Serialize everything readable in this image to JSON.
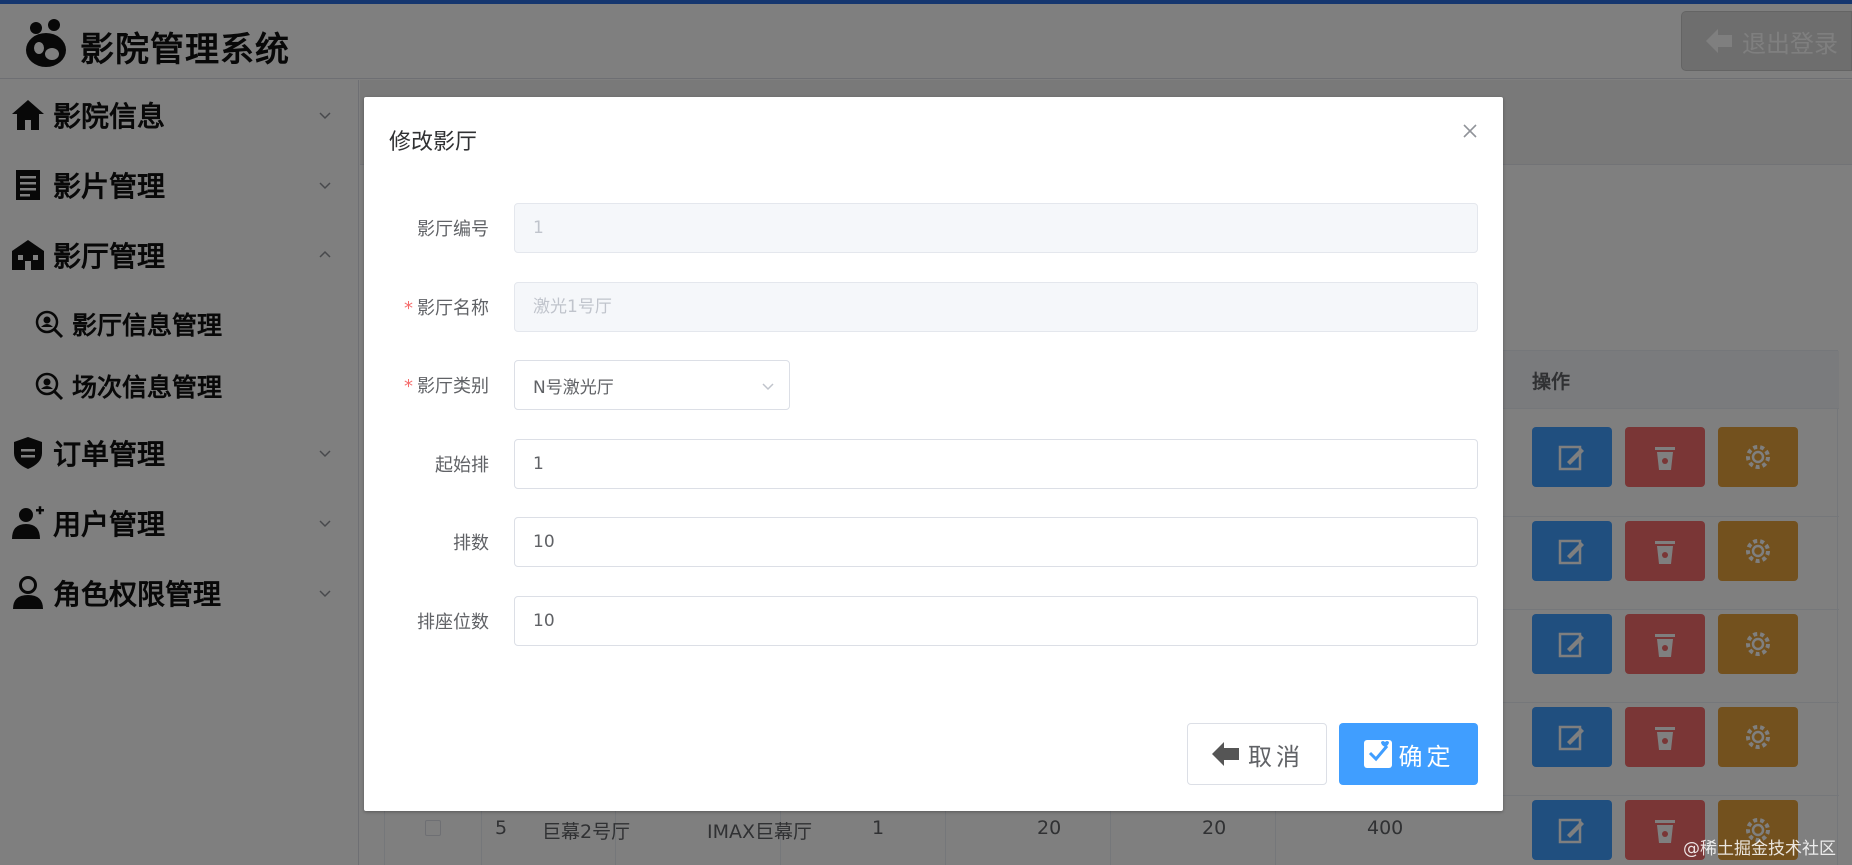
{
  "header": {
    "app_title": "影院管理系统",
    "logout_label": "退出登录"
  },
  "sidebar": {
    "items": [
      {
        "label": "影院信息"
      },
      {
        "label": "影片管理"
      },
      {
        "label": "影厅管理"
      },
      {
        "label": "订单管理"
      },
      {
        "label": "用户管理"
      },
      {
        "label": "角色权限管理"
      }
    ],
    "sub_items": [
      {
        "label": "影厅信息管理"
      },
      {
        "label": "场次信息管理"
      }
    ]
  },
  "table": {
    "op_header": "操作",
    "visible_row": {
      "id": "5",
      "name": "巨幕2号厅",
      "type": "IMAX巨幕厅",
      "start_row": "1",
      "rows": "20",
      "seats_per_row": "20",
      "total": "400"
    }
  },
  "dialog": {
    "title": "修改影厅",
    "fields": {
      "hall_id": {
        "label": "影厅编号",
        "value": "1"
      },
      "hall_name": {
        "label": "影厅名称",
        "placeholder": "激光1号厅"
      },
      "hall_type": {
        "label": "影厅类别",
        "value": "N号激光厅"
      },
      "start_row": {
        "label": "起始排",
        "value": "1"
      },
      "row_count": {
        "label": "排数",
        "value": "10"
      },
      "seats_per_row": {
        "label": "排座位数",
        "value": "10"
      }
    },
    "required_mark": "*",
    "cancel_label": "取消",
    "ok_label": "确定"
  },
  "watermark": "@稀土掘金技术社区",
  "colors": {
    "primary": "#409eff",
    "danger": "#f56c6c",
    "warning": "#e6a23c",
    "topline": "#2b6cdf"
  }
}
